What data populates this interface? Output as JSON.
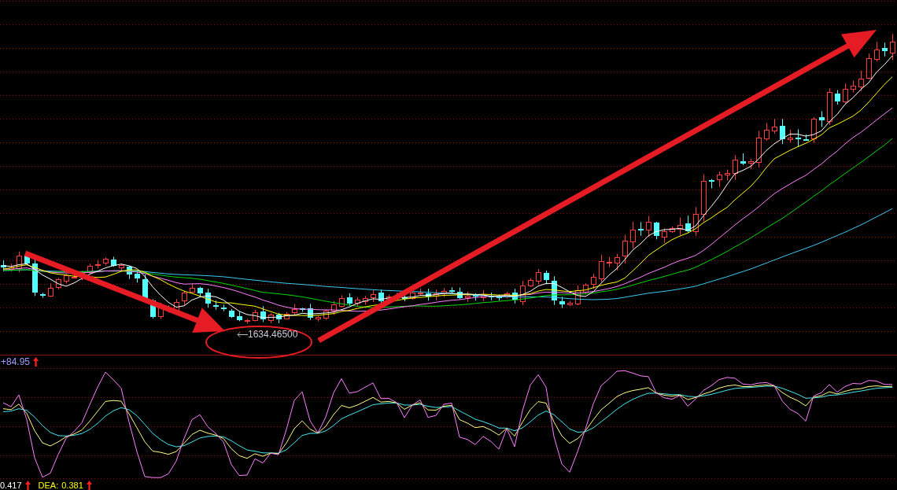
{
  "price_chart": {
    "low_marker": {
      "label": "1634.46500"
    }
  },
  "indicator_chart": {
    "header": {
      "value": "+84.95",
      "rising": true
    }
  },
  "readouts": [
    {
      "value": "0.417",
      "rising": true,
      "color": "#ffffff"
    },
    {
      "label": "DEA:",
      "value": "0.381",
      "rising": true,
      "color": "#ffff00"
    }
  ]
}
